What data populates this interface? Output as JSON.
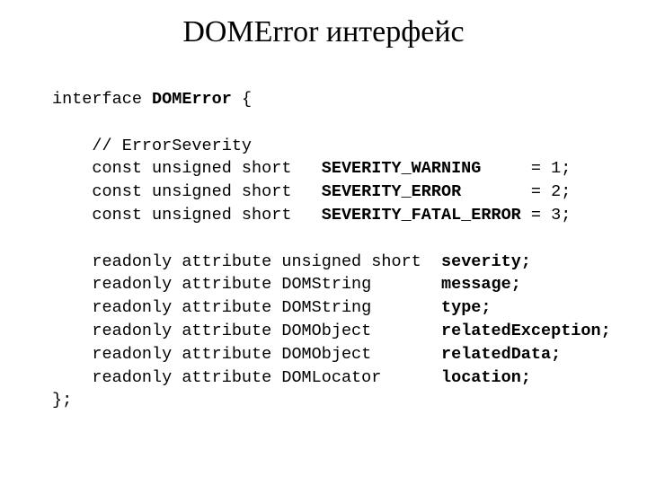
{
  "slide": {
    "title": "DOMError интерфейс",
    "background_color": "#ffffff",
    "text_color": "#000000"
  },
  "code": {
    "language": "IDL",
    "lines": [
      {
        "id": "interface-decl",
        "segments": [
          {
            "text": "interface ",
            "bold": false
          },
          {
            "text": "DOMError",
            "bold": true
          },
          {
            "text": " {",
            "bold": false
          }
        ]
      },
      {
        "id": "blank-1",
        "segments": [
          {
            "text": " ",
            "bold": false
          }
        ]
      },
      {
        "id": "comment-errorseverity",
        "segments": [
          {
            "text": "    // ErrorSeverity",
            "bold": false
          }
        ]
      },
      {
        "id": "const-severity-warning",
        "segments": [
          {
            "text": "    const unsigned short   ",
            "bold": false
          },
          {
            "text": "SEVERITY_WARNING",
            "bold": true
          },
          {
            "text": "     = 1;",
            "bold": false
          }
        ]
      },
      {
        "id": "const-severity-error",
        "segments": [
          {
            "text": "    const unsigned short   ",
            "bold": false
          },
          {
            "text": "SEVERITY_ERROR",
            "bold": true
          },
          {
            "text": "       = 2;",
            "bold": false
          }
        ]
      },
      {
        "id": "const-severity-fatal-error",
        "segments": [
          {
            "text": "    const unsigned short   ",
            "bold": false
          },
          {
            "text": "SEVERITY_FATAL_ERROR",
            "bold": true
          },
          {
            "text": " = 3;",
            "bold": false
          }
        ]
      },
      {
        "id": "blank-2",
        "segments": [
          {
            "text": " ",
            "bold": false
          }
        ]
      },
      {
        "id": "attr-severity",
        "segments": [
          {
            "text": "    readonly attribute unsigned short  ",
            "bold": false
          },
          {
            "text": "severity;",
            "bold": true
          }
        ]
      },
      {
        "id": "attr-message",
        "segments": [
          {
            "text": "    readonly attribute DOMString       ",
            "bold": false
          },
          {
            "text": "message;",
            "bold": true
          }
        ]
      },
      {
        "id": "attr-type",
        "segments": [
          {
            "text": "    readonly attribute DOMString       ",
            "bold": false
          },
          {
            "text": "type;",
            "bold": true
          }
        ]
      },
      {
        "id": "attr-relatedexception",
        "segments": [
          {
            "text": "    readonly attribute DOMObject       ",
            "bold": false
          },
          {
            "text": "relatedException;",
            "bold": true
          }
        ]
      },
      {
        "id": "attr-relateddata",
        "segments": [
          {
            "text": "    readonly attribute DOMObject       ",
            "bold": false
          },
          {
            "text": "relatedData;",
            "bold": true
          }
        ]
      },
      {
        "id": "attr-location",
        "segments": [
          {
            "text": "    readonly attribute DOMLocator      ",
            "bold": false
          },
          {
            "text": "location;",
            "bold": true
          }
        ]
      },
      {
        "id": "interface-close",
        "segments": [
          {
            "text": "};",
            "bold": false
          }
        ]
      }
    ]
  }
}
